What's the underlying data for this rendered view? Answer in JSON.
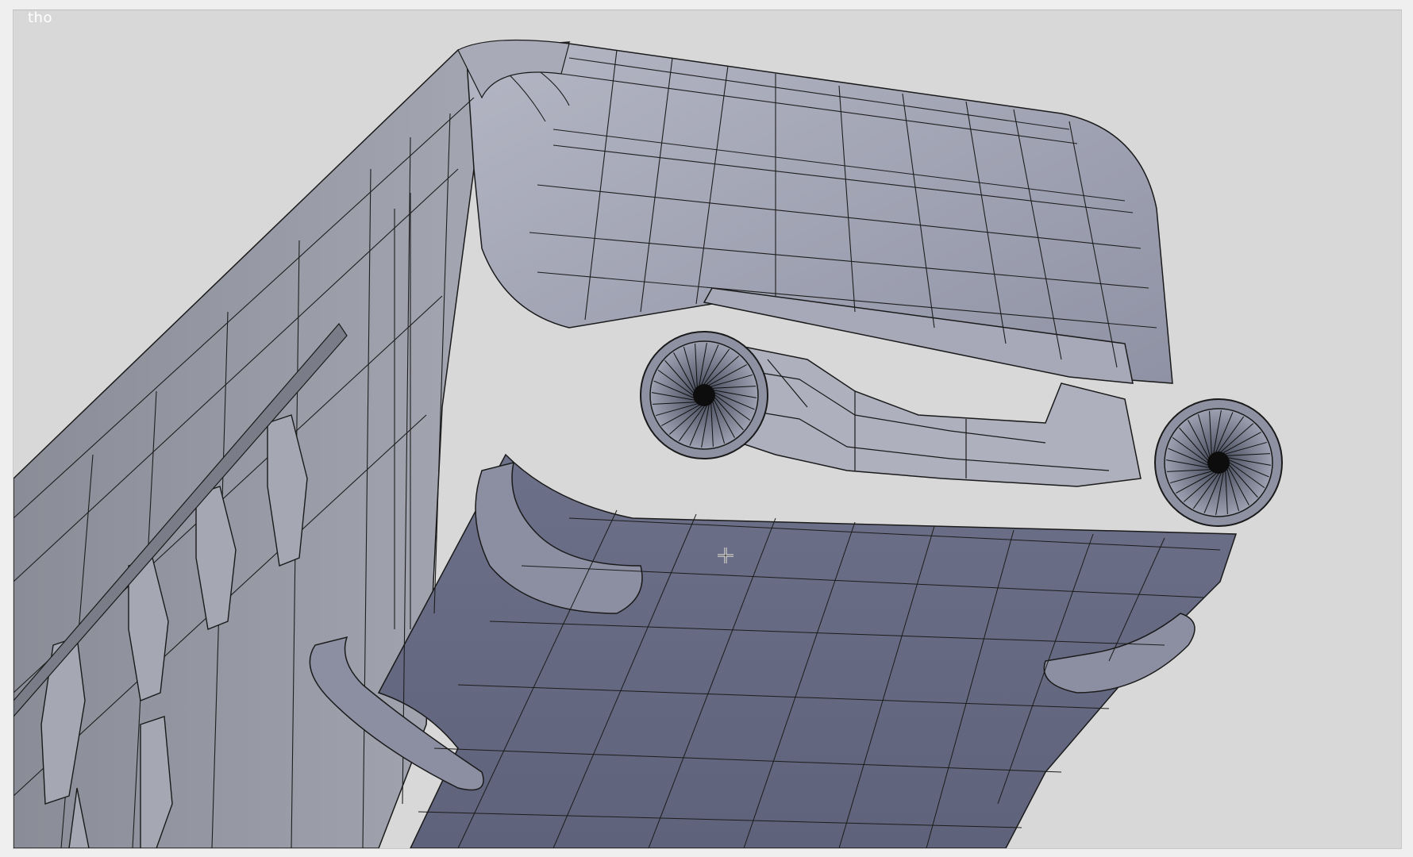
{
  "viewport": {
    "label": "tho",
    "background_color": "#d8d8d8",
    "mesh_fill_color": "#9a9caa",
    "mesh_shadow_color": "#676b82",
    "wire_color": "#141414"
  },
  "model": {
    "description_icon": "wireframe-mesh",
    "fan_count": 2
  },
  "cursor": {
    "icon": "crosshair-cursor"
  }
}
